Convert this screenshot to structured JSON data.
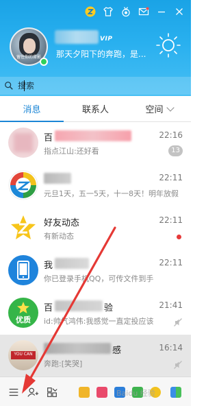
{
  "header": {
    "vip_label": "VIP",
    "signature": "那天夕阳下的奔跑，是...",
    "avatar_caption": "留住你的背影"
  },
  "search": {
    "placeholder": "搜索"
  },
  "tabs": [
    {
      "label": "消息",
      "active": true
    },
    {
      "label": "联系人",
      "active": false
    },
    {
      "label": "空间",
      "active": false
    }
  ],
  "messages": [
    {
      "title": "百",
      "subtitle": "指点江山:还好看",
      "time": "22:16",
      "badge": "13",
      "indicator": "badge",
      "icon": "blurred-avatar"
    },
    {
      "title": "",
      "subtitle": "元旦1天，五一5天，十一8天！明年放假",
      "time": "22:11",
      "indicator": "none",
      "icon": "qzone-logo-icon"
    },
    {
      "title": "好友动态",
      "subtitle": "有新动态",
      "time": "22:11",
      "indicator": "reddot",
      "icon": "friend-feed-icon"
    },
    {
      "title": "我",
      "subtitle": "你已登录手机QQ，可传文件到手",
      "time": "22:11",
      "indicator": "none",
      "icon": "phone-device-icon"
    },
    {
      "title": "百",
      "title_suffix": "验",
      "subtitle": "id:帅气鸿伟:我感觉一直定投应该",
      "time": "21:41",
      "indicator": "mute",
      "icon": "quality-badge-icon",
      "icon_label": "优质"
    },
    {
      "title": "",
      "title_suffix": "感",
      "subtitle": "奔跑:[笑哭]",
      "time": "16:14",
      "indicator": "mute",
      "icon": "blurred-photo",
      "selected": true
    }
  ],
  "bottom": {
    "watermark": "Baidu 经验",
    "apps": [
      "game-icon",
      "video-icon",
      "kandian-icon",
      "play-icon",
      "star-icon",
      "apps-grid-icon"
    ]
  },
  "colors": {
    "header": "#29b0ef",
    "accent": "#1b86d6",
    "annotation": "#e53935",
    "online": "#2fd05b"
  }
}
